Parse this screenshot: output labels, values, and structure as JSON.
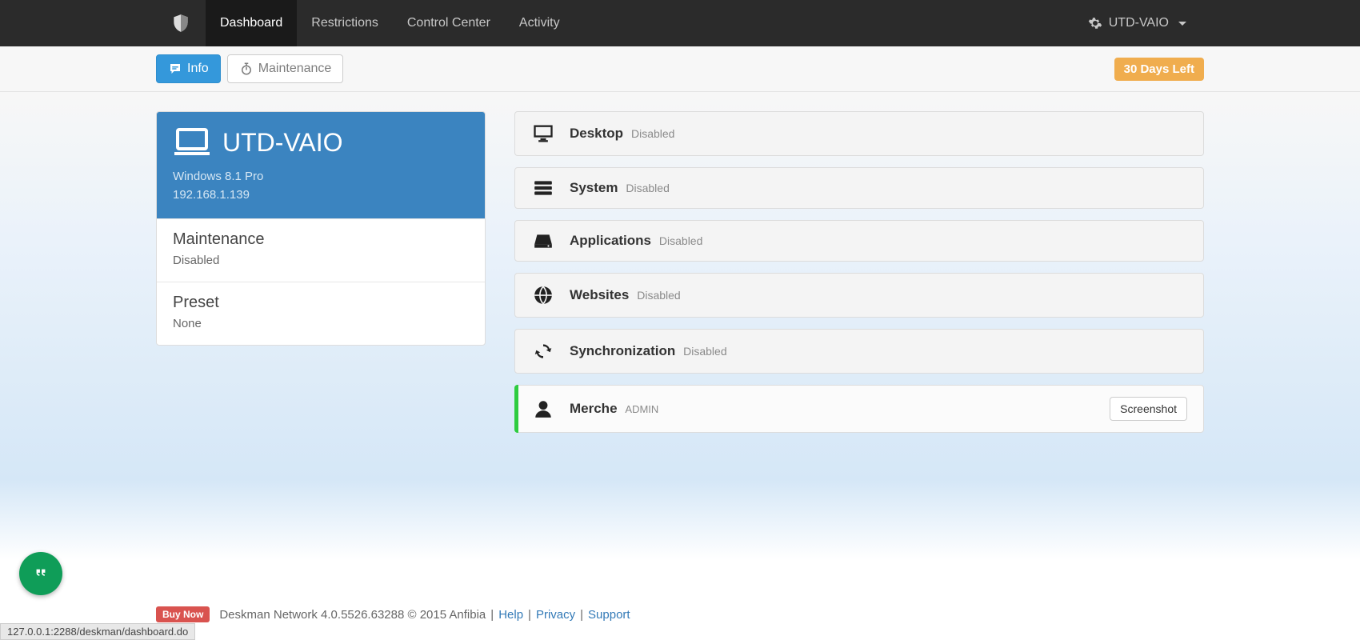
{
  "nav": {
    "items": [
      "Dashboard",
      "Restrictions",
      "Control Center",
      "Activity"
    ],
    "active_index": 0,
    "user_label": "UTD-VAIO"
  },
  "subbar": {
    "info_label": "Info",
    "maintenance_label": "Maintenance",
    "trial_badge": "30 Days Left"
  },
  "device": {
    "name": "UTD-VAIO",
    "os": "Windows 8.1 Pro",
    "ip": "192.168.1.139",
    "maintenance_label": "Maintenance",
    "maintenance_value": "Disabled",
    "preset_label": "Preset",
    "preset_value": "None"
  },
  "panels": [
    {
      "title": "Desktop",
      "status": "Disabled",
      "icon": "monitor"
    },
    {
      "title": "System",
      "status": "Disabled",
      "icon": "server"
    },
    {
      "title": "Applications",
      "status": "Disabled",
      "icon": "drive"
    },
    {
      "title": "Websites",
      "status": "Disabled",
      "icon": "globe"
    },
    {
      "title": "Synchronization",
      "status": "Disabled",
      "icon": "sync"
    }
  ],
  "user_panel": {
    "name": "Merche",
    "role": "ADMIN",
    "screenshot_btn": "Screenshot"
  },
  "footer": {
    "buy_now": "Buy Now",
    "product": "Deskman Network 4.0.5526.63288 © 2015 Anfibia",
    "help": "Help",
    "privacy": "Privacy",
    "support": "Support"
  },
  "status_url": "127.0.0.1:2288/deskman/dashboard.do"
}
